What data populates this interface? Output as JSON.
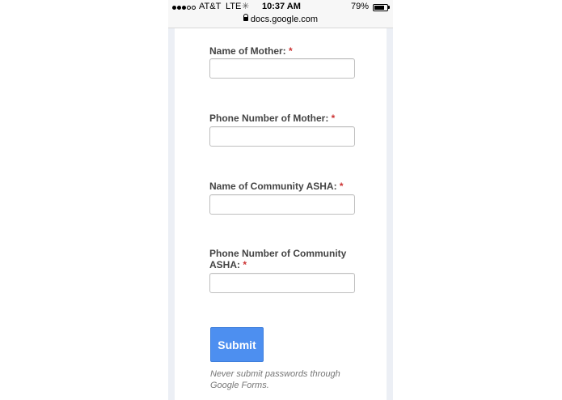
{
  "status_bar": {
    "signal_full": 3,
    "signal_empty": 2,
    "carrier": "AT&T",
    "network": "LTE",
    "time": "10:37 AM",
    "battery_percent": "79%",
    "battery_level": 0.79
  },
  "url_bar": {
    "domain": "docs.google.com",
    "icon": "lock-icon"
  },
  "form": {
    "questions": [
      {
        "label": "Name of Mother:",
        "required_mark": "*",
        "value": ""
      },
      {
        "label": "Phone Number of Mother:",
        "required_mark": "*",
        "value": ""
      },
      {
        "label": "Name of Community ASHA:",
        "required_mark": "*",
        "value": ""
      },
      {
        "label": "Phone Number of Community ASHA:",
        "required_mark": "*",
        "value": ""
      }
    ],
    "submit_label": "Submit",
    "disclaimer": "Never submit passwords through Google Forms."
  },
  "colors": {
    "submit": "#4d8ff0",
    "required": "#cc3333",
    "page_background": "#eceff5"
  }
}
